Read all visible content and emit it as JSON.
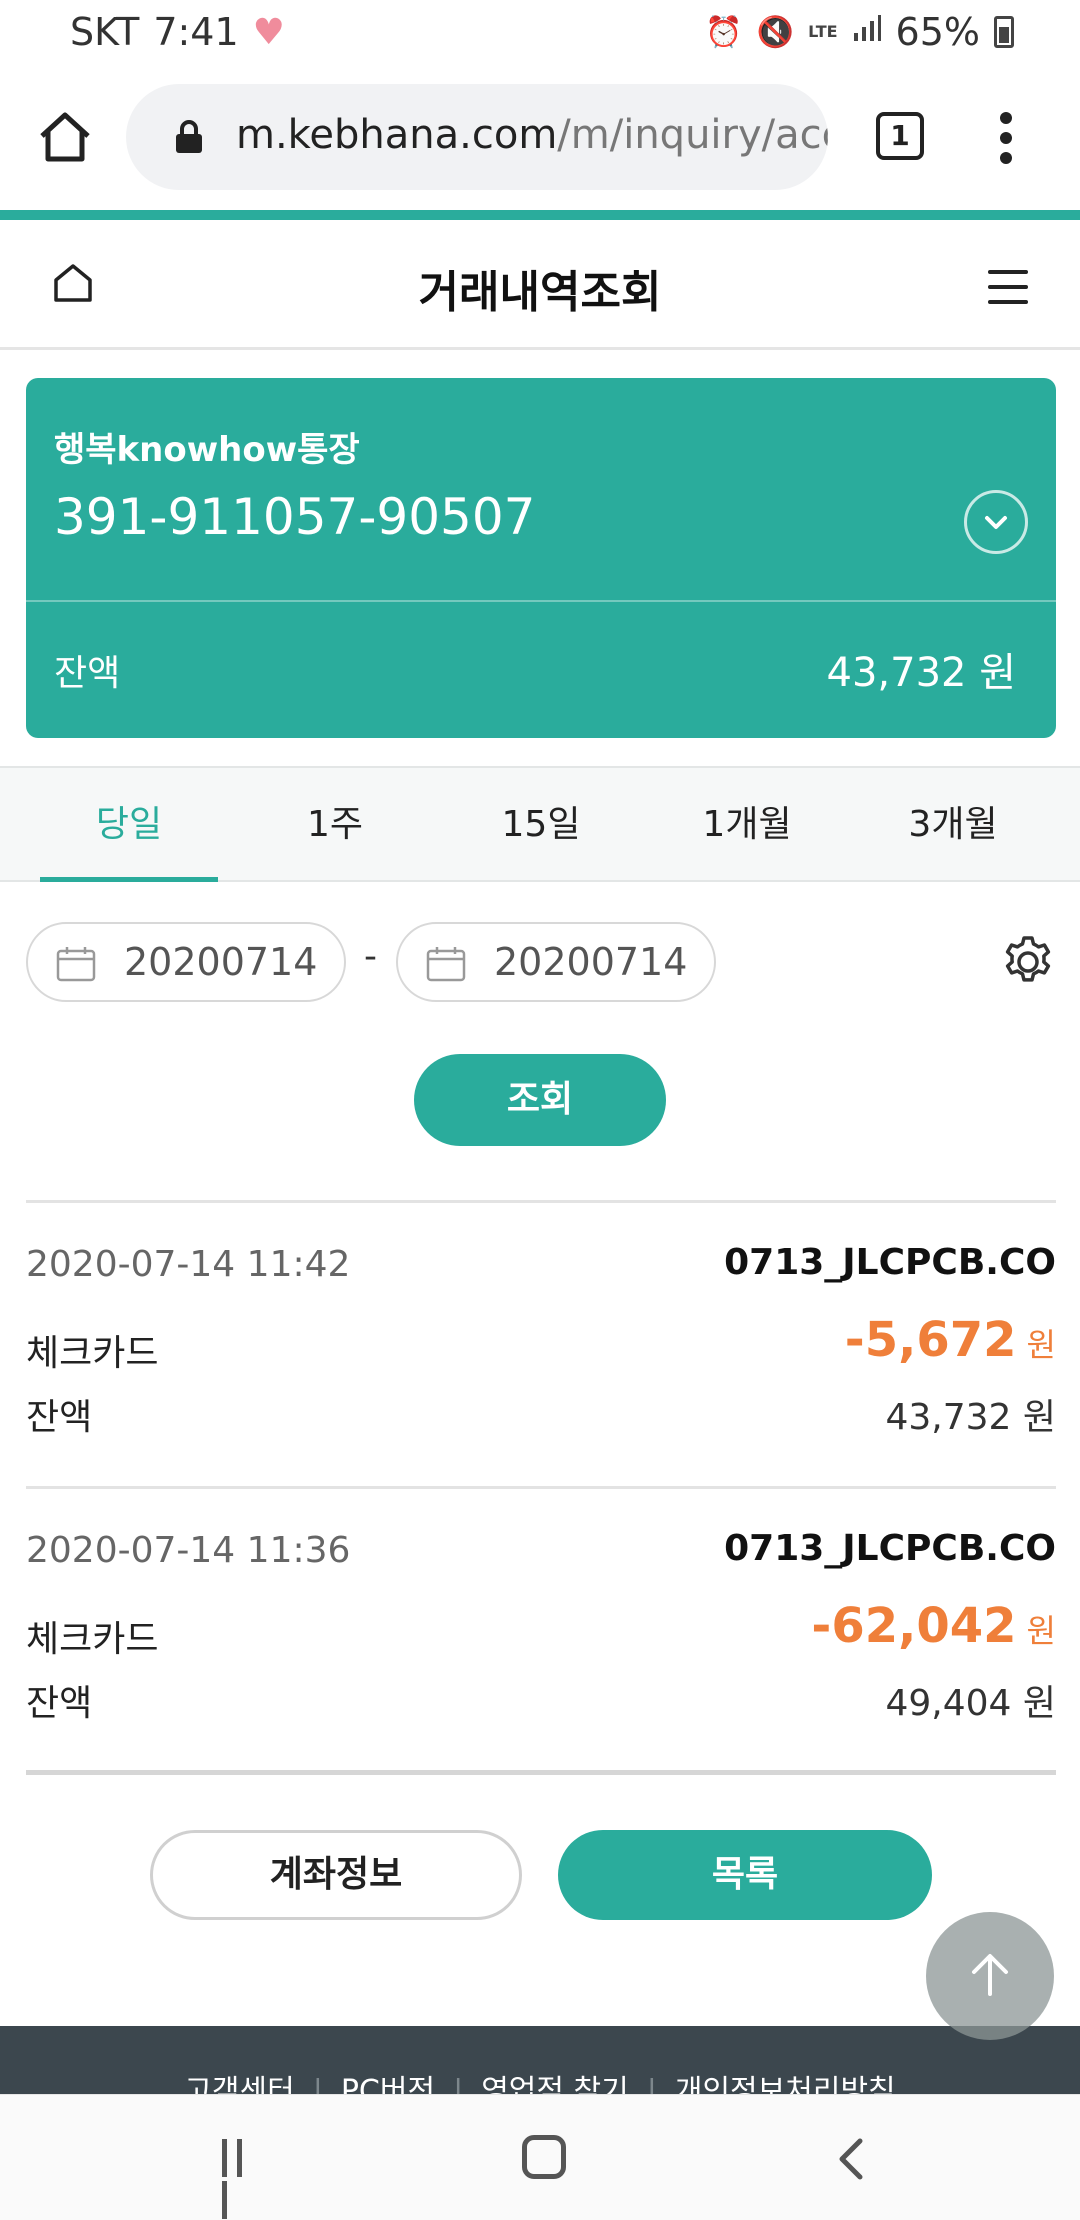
{
  "status_bar": {
    "carrier": "SKT",
    "time": "7:41",
    "network": "LTE",
    "battery": "65%"
  },
  "browser": {
    "url_domain": "m.kebhana.com",
    "url_path": "/m/inquiry/acc",
    "tab_count": "1"
  },
  "header": {
    "title": "거래내역조회"
  },
  "account": {
    "name": "행복knowhow통장",
    "number": "391-911057-90507",
    "balance_label": "잔액",
    "balance_value": "43,732 원"
  },
  "period_tabs": [
    {
      "label": "당일",
      "active": true
    },
    {
      "label": "1주",
      "active": false
    },
    {
      "label": "15일",
      "active": false
    },
    {
      "label": "1개월",
      "active": false
    },
    {
      "label": "3개월",
      "active": false
    }
  ],
  "date_range": {
    "start": "20200714",
    "separator": "-",
    "end": "20200714"
  },
  "search_button": "조회",
  "transactions": [
    {
      "datetime": "2020-07-14 11:42",
      "memo": "0713_JLCPCB.CO",
      "type": "체크카드",
      "amount": "-5,672",
      "currency": "원",
      "balance_label": "잔액",
      "balance": "43,732 원"
    },
    {
      "datetime": "2020-07-14 11:36",
      "memo": "0713_JLCPCB.CO",
      "type": "체크카드",
      "amount": "-62,042",
      "currency": "원",
      "balance_label": "잔액",
      "balance": "49,404 원"
    }
  ],
  "buttons": {
    "account_info": "계좌정보",
    "list": "목록"
  },
  "footer": {
    "links": [
      "고객센터",
      "PC버전",
      "영업점 찾기",
      "개인정보처리방침"
    ]
  },
  "colors": {
    "accent": "#2aac9c",
    "withdrawal": "#ef7f3a",
    "footer_bg": "#3c474e"
  }
}
